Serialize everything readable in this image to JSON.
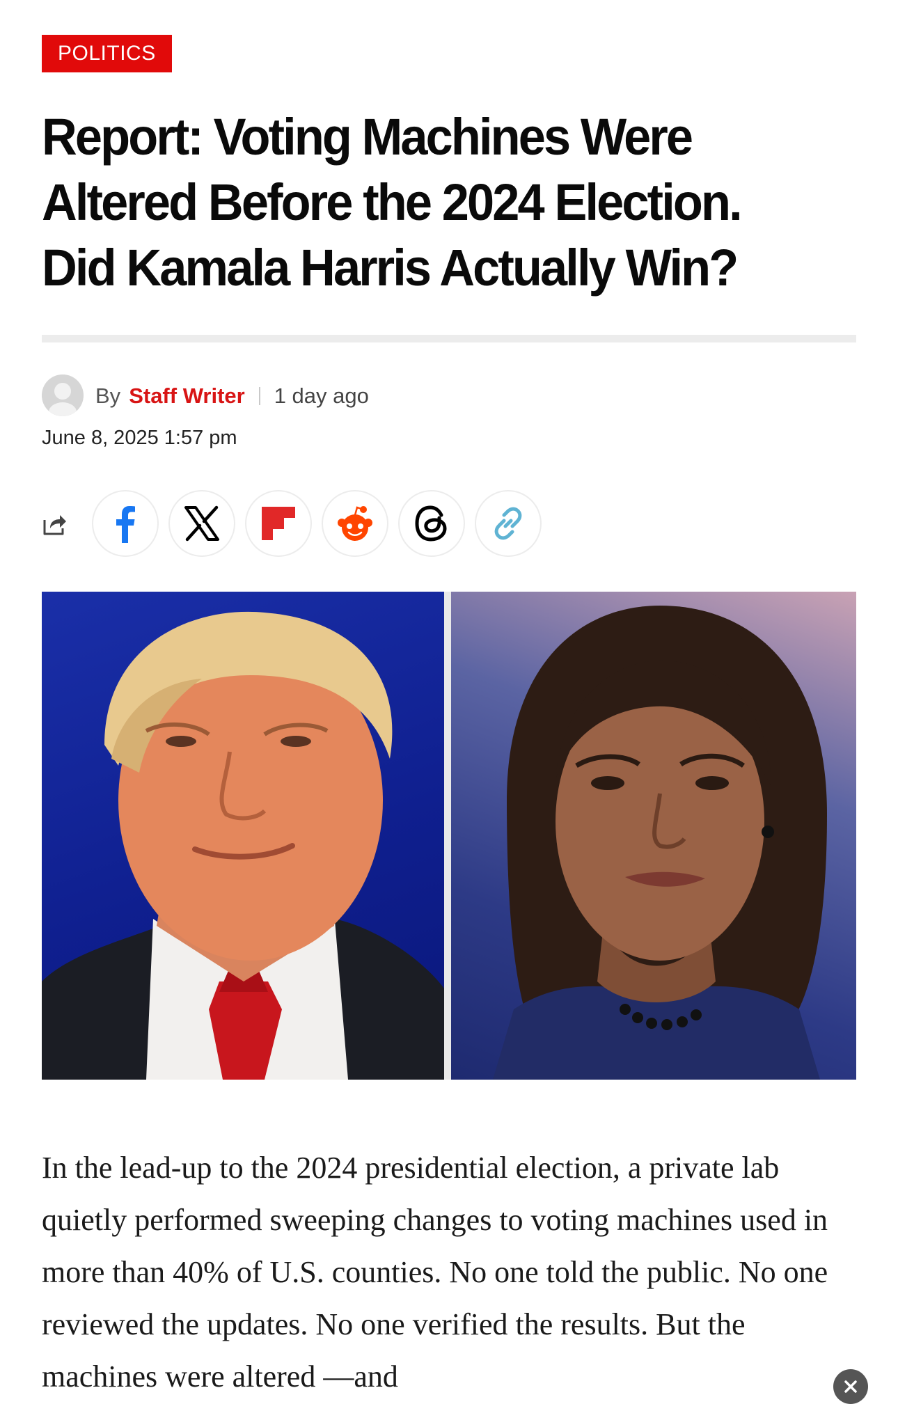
{
  "article": {
    "category": "POLITICS",
    "headline": "Report: Voting Machines Were Altered Before the 2024 Election. Did Kamala Harris Actually Win?",
    "byline_prefix": "By",
    "author": "Staff Writer",
    "relative_time": "1 day ago",
    "date": "June 8, 2025 1:57 pm",
    "body": "In the lead-up to the 2024 presidential election, a private lab quietly performed sweeping changes to voting machines used in more than 40% of U.S. counties. No one told the public. No one reviewed the updates. No one verified the results. But the machines were altered —and"
  },
  "share": {
    "icon": "share-icon",
    "buttons": [
      {
        "name": "facebook",
        "icon": "facebook-icon",
        "color": "#1877f2"
      },
      {
        "name": "x",
        "icon": "x-icon",
        "color": "#000000"
      },
      {
        "name": "flipboard",
        "icon": "flipboard-icon",
        "color": "#e12828"
      },
      {
        "name": "reddit",
        "icon": "reddit-icon",
        "color": "#ff4500"
      },
      {
        "name": "threads",
        "icon": "threads-icon",
        "color": "#000000"
      },
      {
        "name": "copy-link",
        "icon": "link-icon",
        "color": "#5fb3d3"
      }
    ]
  },
  "hero_image": {
    "left_subject": "Donald Trump",
    "right_subject": "Kamala Harris"
  },
  "overlay": {
    "close_icon": "close-icon"
  },
  "colors": {
    "accent": "#e10a0a",
    "author": "#d81414"
  }
}
